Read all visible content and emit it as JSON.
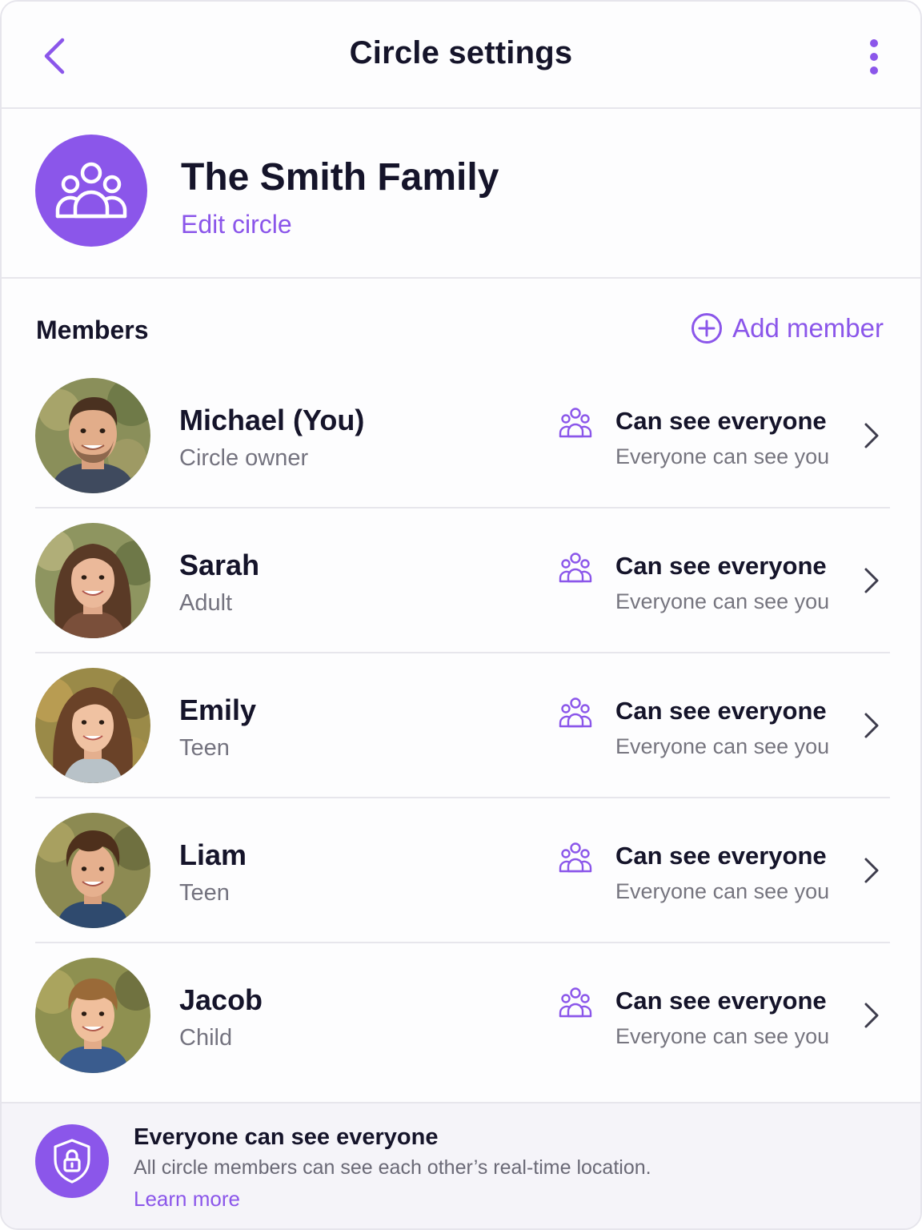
{
  "header": {
    "title": "Circle settings",
    "back_icon": "chevron-left-icon",
    "more_icon": "more-vertical-icon"
  },
  "circle": {
    "name": "The Smith Family",
    "edit_label": "Edit circle",
    "icon": "group-icon",
    "color": "#8b56ea"
  },
  "members_section": {
    "title": "Members",
    "add_label": "Add member",
    "add_icon": "plus-circle-icon"
  },
  "members": [
    {
      "name": "Michael (You)",
      "role": "Circle owner",
      "permission": "Can see everyone",
      "visibility": "Everyone can see you"
    },
    {
      "name": "Sarah",
      "role": "Adult",
      "permission": "Can see everyone",
      "visibility": "Everyone can see you"
    },
    {
      "name": "Emily",
      "role": "Teen",
      "permission": "Can see everyone",
      "visibility": "Everyone can see you"
    },
    {
      "name": "Liam",
      "role": "Teen",
      "permission": "Can see everyone",
      "visibility": "Everyone can see you"
    },
    {
      "name": "Jacob",
      "role": "Child",
      "permission": "Can see everyone",
      "visibility": "Everyone can see you"
    }
  ],
  "footer": {
    "title": "Everyone can see everyone",
    "description": "All circle members can see each other’s real-time location.",
    "link": "Learn more",
    "icon": "shield-lock-icon"
  },
  "colors": {
    "accent": "#8b56ea",
    "text_primary": "#15142a",
    "text_secondary": "#74737f",
    "divider": "#e7e6ec"
  }
}
